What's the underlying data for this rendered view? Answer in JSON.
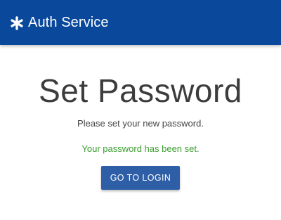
{
  "app_bar": {
    "brand_icon": "asterisk-icon",
    "title": "Auth Service",
    "background_color": "#0a489c"
  },
  "main": {
    "title": "Set Password",
    "subtitle": "Please set your new password.",
    "success_message": "Your password has been set.",
    "success_color": "#3a9d2e",
    "login_button_label": "GO TO LOGIN",
    "login_button_color": "#2d5ea6"
  }
}
